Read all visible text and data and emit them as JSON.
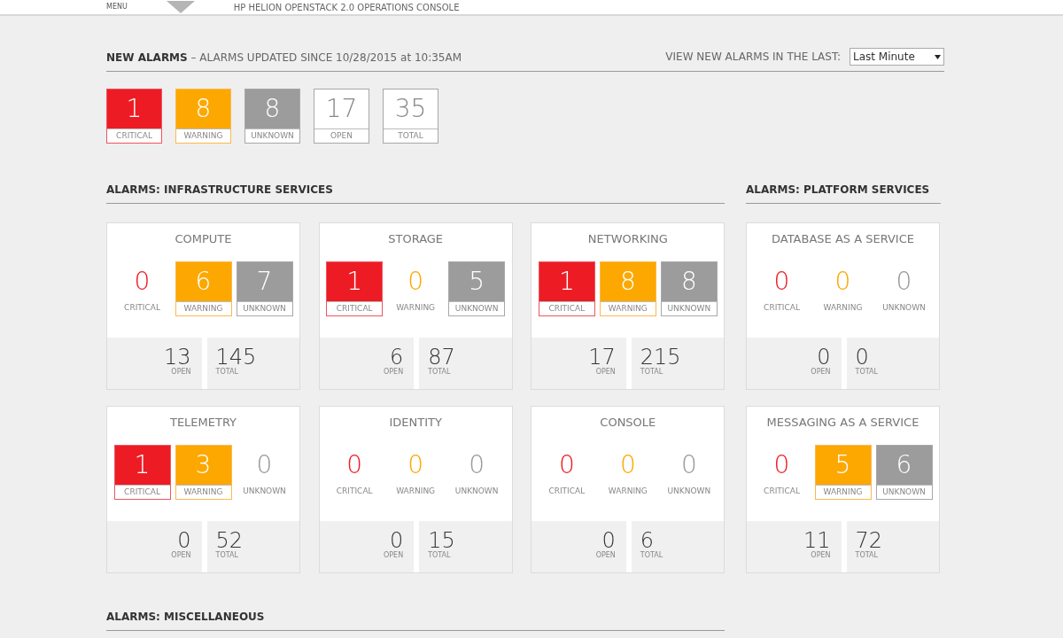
{
  "header": {
    "menu_label": "MENU",
    "console_title": "HP HELION OPENSTACK 2.0 OPERATIONS CONSOLE"
  },
  "new_alarms": {
    "title": "NEW ALARMS",
    "subtitle": "– ALARMS UPDATED SINCE 10/28/2015 at 10:35AM",
    "filter_label": "VIEW NEW ALARMS IN THE LAST:",
    "filter_value": "Last Minute",
    "counts": [
      {
        "kind": "critical",
        "value": "1",
        "label": "CRITICAL"
      },
      {
        "kind": "warning",
        "value": "8",
        "label": "WARNING"
      },
      {
        "kind": "unknown",
        "value": "8",
        "label": "UNKNOWN"
      },
      {
        "kind": "open",
        "value": "17",
        "label": "OPEN"
      },
      {
        "kind": "total",
        "value": "35",
        "label": "TOTAL"
      }
    ]
  },
  "infrastructure": {
    "title": "ALARMS: INFRASTRUCTURE SERVICES",
    "cards": [
      {
        "name": "COMPUTE",
        "counts": [
          {
            "kind": "critical",
            "value": "0",
            "label": "CRITICAL",
            "active": false
          },
          {
            "kind": "warning",
            "value": "6",
            "label": "WARNING",
            "active": true
          },
          {
            "kind": "unknown",
            "value": "7",
            "label": "UNKNOWN",
            "active": true
          }
        ],
        "open": "13",
        "open_label": "OPEN",
        "total": "145",
        "total_label": "TOTAL"
      },
      {
        "name": "STORAGE",
        "counts": [
          {
            "kind": "critical",
            "value": "1",
            "label": "CRITICAL",
            "active": true
          },
          {
            "kind": "warning",
            "value": "0",
            "label": "WARNING",
            "active": false
          },
          {
            "kind": "unknown",
            "value": "5",
            "label": "UNKNOWN",
            "active": true
          }
        ],
        "open": "6",
        "open_label": "OPEN",
        "total": "87",
        "total_label": "TOTAL"
      },
      {
        "name": "NETWORKING",
        "counts": [
          {
            "kind": "critical",
            "value": "1",
            "label": "CRITICAL",
            "active": true
          },
          {
            "kind": "warning",
            "value": "8",
            "label": "WARNING",
            "active": true
          },
          {
            "kind": "unknown",
            "value": "8",
            "label": "UNKNOWN",
            "active": true
          }
        ],
        "open": "17",
        "open_label": "OPEN",
        "total": "215",
        "total_label": "TOTAL"
      },
      {
        "name": "TELEMETRY",
        "counts": [
          {
            "kind": "critical",
            "value": "1",
            "label": "CRITICAL",
            "active": true
          },
          {
            "kind": "warning",
            "value": "3",
            "label": "WARNING",
            "active": true
          },
          {
            "kind": "unknown",
            "value": "0",
            "label": "UNKNOWN",
            "active": false
          }
        ],
        "open": "0",
        "open_label": "OPEN",
        "total": "52",
        "total_label": "TOTAL"
      },
      {
        "name": "IDENTITY",
        "counts": [
          {
            "kind": "critical",
            "value": "0",
            "label": "CRITICAL",
            "active": false
          },
          {
            "kind": "warning",
            "value": "0",
            "label": "WARNING",
            "active": false
          },
          {
            "kind": "unknown",
            "value": "0",
            "label": "UNKNOWN",
            "active": false
          }
        ],
        "open": "0",
        "open_label": "OPEN",
        "total": "15",
        "total_label": "TOTAL"
      },
      {
        "name": "CONSOLE",
        "counts": [
          {
            "kind": "critical",
            "value": "0",
            "label": "CRITICAL",
            "active": false
          },
          {
            "kind": "warning",
            "value": "0",
            "label": "WARNING",
            "active": false
          },
          {
            "kind": "unknown",
            "value": "0",
            "label": "UNKNOWN",
            "active": false
          }
        ],
        "open": "0",
        "open_label": "OPEN",
        "total": "6",
        "total_label": "TOTAL"
      }
    ]
  },
  "platform": {
    "title": "ALARMS: PLATFORM SERVICES",
    "cards": [
      {
        "name": "DATABASE AS A SERVICE",
        "counts": [
          {
            "kind": "critical",
            "value": "0",
            "label": "CRITICAL",
            "active": false
          },
          {
            "kind": "warning",
            "value": "0",
            "label": "WARNING",
            "active": false
          },
          {
            "kind": "unknown",
            "value": "0",
            "label": "UNKNOWN",
            "active": false
          }
        ],
        "open": "0",
        "open_label": "OPEN",
        "total": "0",
        "total_label": "TOTAL"
      },
      {
        "name": "MESSAGING AS A SERVICE",
        "counts": [
          {
            "kind": "critical",
            "value": "0",
            "label": "CRITICAL",
            "active": false
          },
          {
            "kind": "warning",
            "value": "5",
            "label": "WARNING",
            "active": true
          },
          {
            "kind": "unknown",
            "value": "6",
            "label": "UNKNOWN",
            "active": true
          }
        ],
        "open": "11",
        "open_label": "OPEN",
        "total": "72",
        "total_label": "TOTAL"
      }
    ]
  },
  "miscellaneous": {
    "title": "ALARMS: MISCELLANEOUS"
  }
}
